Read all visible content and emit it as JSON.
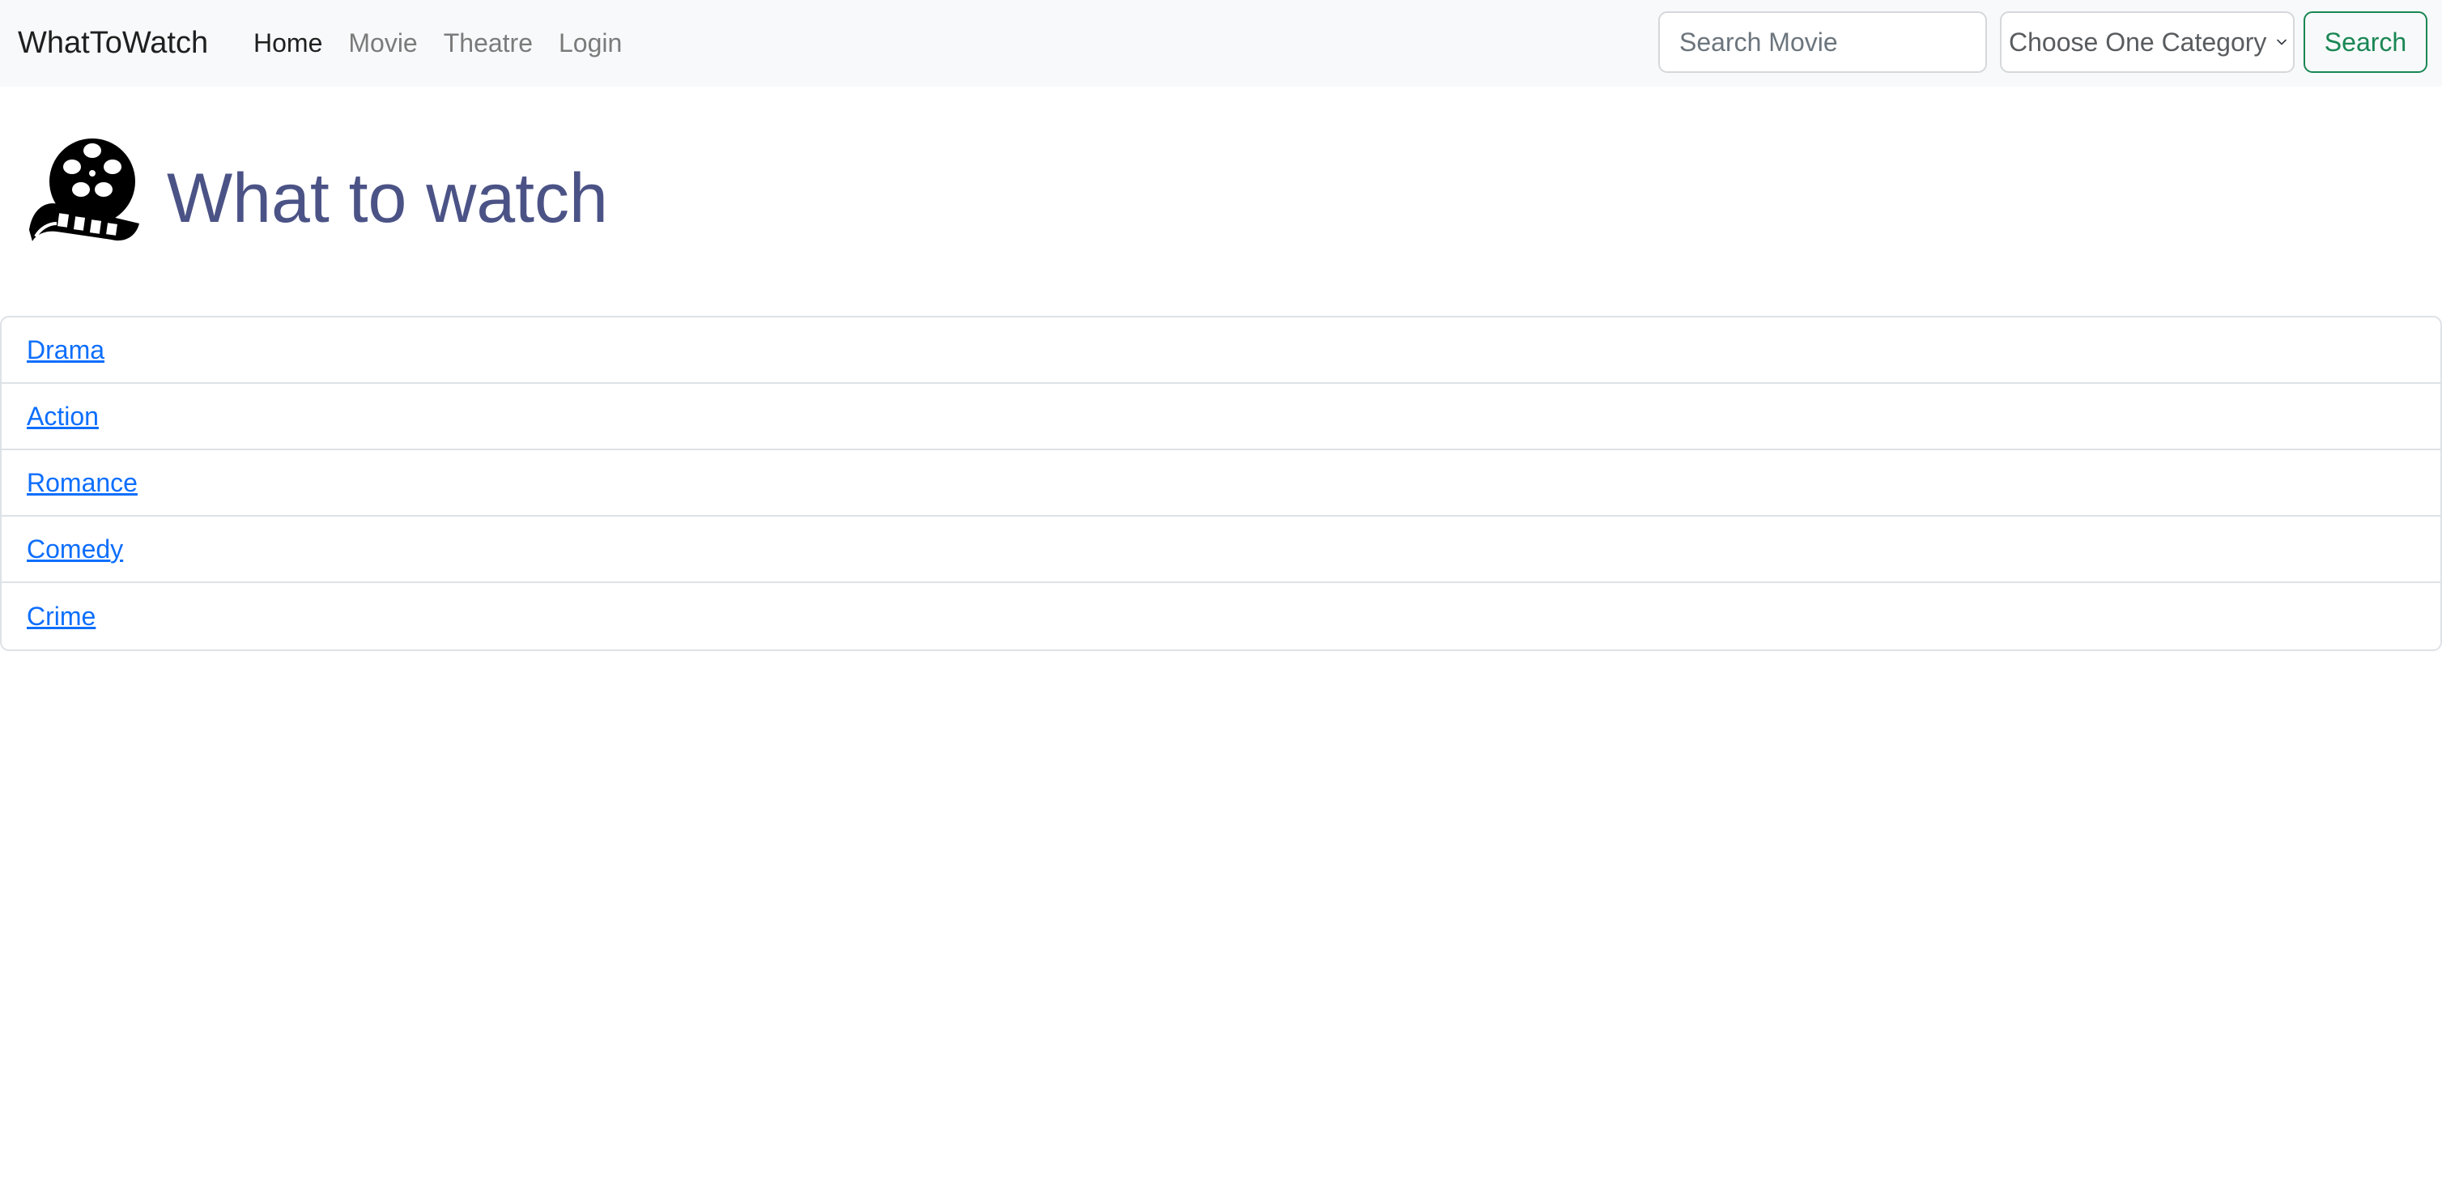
{
  "navbar": {
    "brand": "WhatToWatch",
    "links": [
      "Home",
      "Movie",
      "Theatre",
      "Login"
    ],
    "active_link": "Home",
    "search_placeholder": "Search Movie",
    "category_selected": "Choose One Category",
    "search_button": "Search"
  },
  "main": {
    "title": "What to watch",
    "icon": "film-reel-icon",
    "categories": [
      "Drama",
      "Action",
      "Romance",
      "Comedy",
      "Crime"
    ]
  },
  "colors": {
    "navbar_bg": "#f8f9fa",
    "title": "#4b5386",
    "link": "#0d6efd",
    "search_button": "#198754"
  }
}
